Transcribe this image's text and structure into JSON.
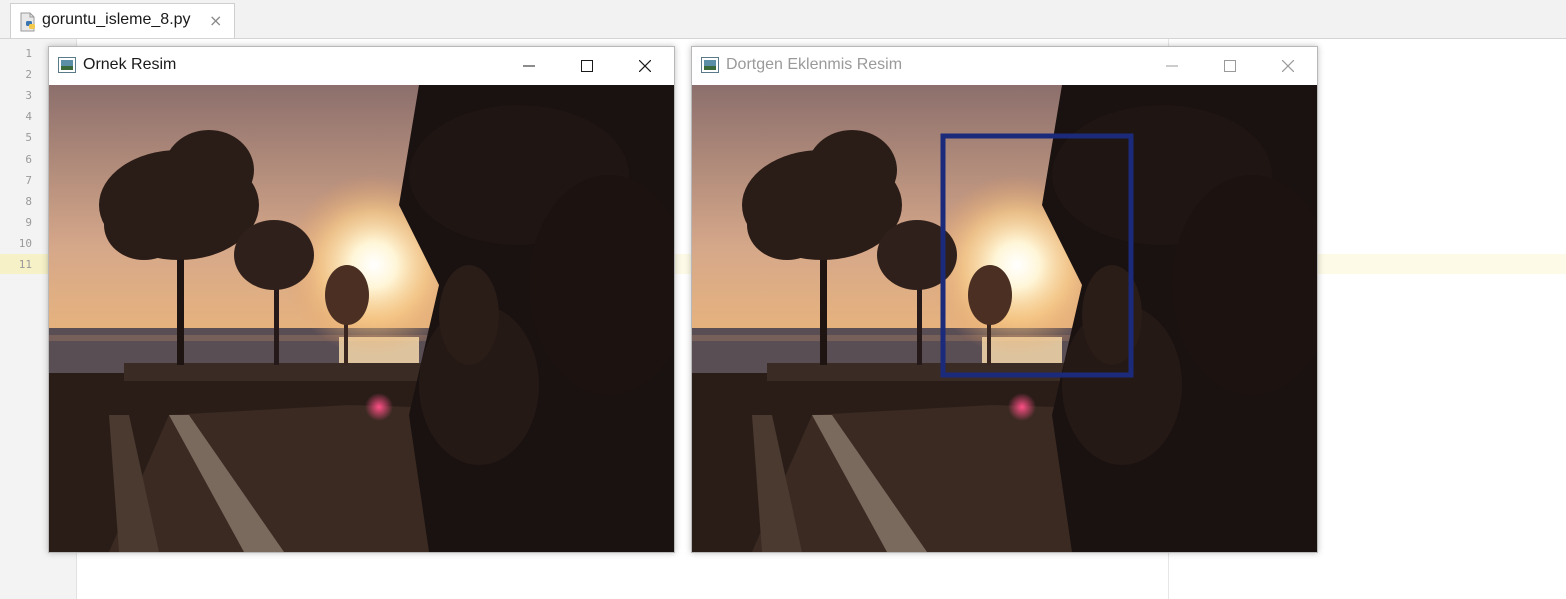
{
  "editor": {
    "tab": {
      "filename": "goruntu_isleme_8.py",
      "close_glyph": "×",
      "icon": "python-file-icon"
    },
    "line_numbers": [
      "1",
      "2",
      "3",
      "4",
      "5",
      "6",
      "7",
      "8",
      "9",
      "10",
      "11"
    ],
    "current_line": "11"
  },
  "windows": [
    {
      "title": "Ornek Resim",
      "active": true,
      "icon": "window-app-icon"
    },
    {
      "title": "Dortgen Eklenmis Resim",
      "active": false,
      "icon": "window-app-icon",
      "rectangle_color": "#1b2a7a"
    }
  ],
  "colors": {
    "active_title": "#1a1a1a",
    "inactive_title": "#9a9a9a",
    "rectangle": "#1b2a7a"
  }
}
